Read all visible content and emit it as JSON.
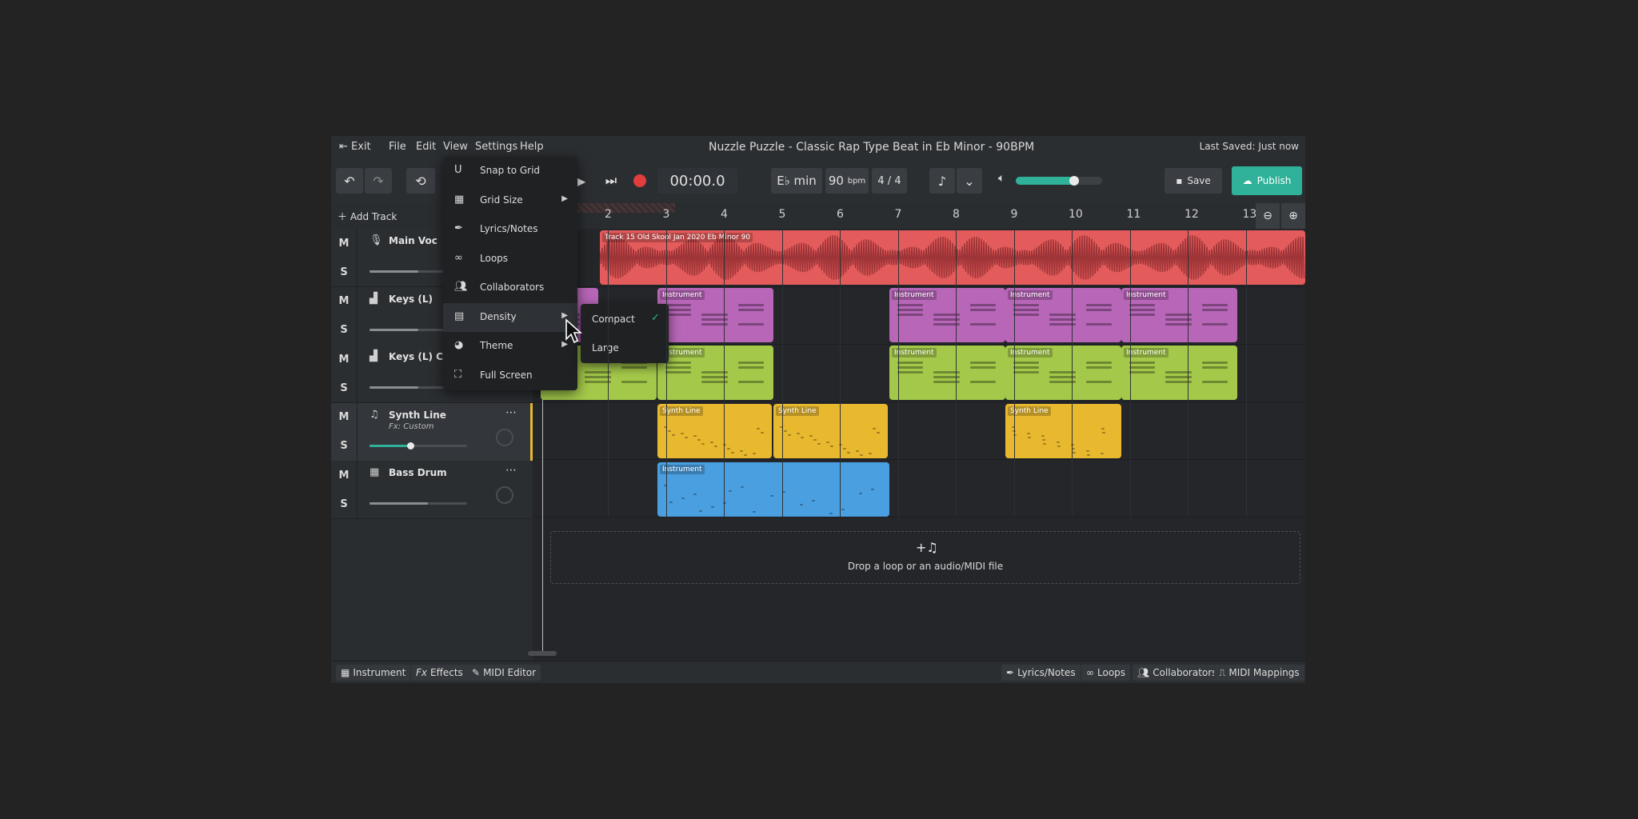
{
  "menubar": {
    "exit": "Exit",
    "file": "File",
    "edit": "Edit",
    "view": "View",
    "settings": "Settings",
    "help": "Help",
    "title": "Nuzzle Puzzle - Classic Rap Type Beat in Eb Minor - 90BPM",
    "last_saved": "Last Saved: Just now"
  },
  "toolbar": {
    "time": "00:00.0",
    "key": "E♭ min",
    "bpm_value": "90",
    "bpm_unit": "bpm",
    "time_signature": "4 / 4",
    "master_volume_level": 0.68,
    "save": "Save",
    "publish": "Publish",
    "accent": "#2fb19a"
  },
  "ruler": {
    "add_track": "Add Track",
    "ticks": [
      "2",
      "3",
      "4",
      "5",
      "6",
      "7",
      "8",
      "9",
      "10",
      "11",
      "12",
      "13"
    ]
  },
  "tracks": [
    {
      "name": "Main Voc",
      "icon": "microphone-icon",
      "mute": "M",
      "solo": "S",
      "volume_level": 0.5
    },
    {
      "name": "Keys (L)",
      "icon": "piano-icon",
      "mute": "M",
      "solo": "S",
      "volume_level": 0.5
    },
    {
      "name": "Keys (L) Copy",
      "icon": "piano-icon",
      "mute": "M",
      "solo": "S",
      "volume_level": 0.5
    },
    {
      "name": "Synth Line",
      "fx": "Fx: Custom",
      "icon": "synth-icon",
      "mute": "M",
      "solo": "S",
      "volume_level": 0.42
    },
    {
      "name": "Bass Drum",
      "icon": "drum-machine-icon",
      "mute": "M",
      "solo": "S",
      "volume_level": 0.6
    }
  ],
  "clips": {
    "audio_label": "Track 15 Old Skool Jan 2020 Eb Minor 90",
    "instrument": "Instrument",
    "synth": "Synth Line",
    "colors": {
      "audio": "#e35b5b",
      "keys": "#b866b8",
      "keys_copy": "#a4c94a",
      "synth": "#e8b92f",
      "drum": "#4a9fe0"
    }
  },
  "dropzone": {
    "icon": "add-music-icon",
    "text": "Drop a loop or an audio/MIDI file"
  },
  "view_menu": {
    "items": [
      {
        "label": "Snap to Grid",
        "icon": "magnet-icon"
      },
      {
        "label": "Grid Size",
        "icon": "grid-icon",
        "submenu": true
      },
      {
        "label": "Lyrics/Notes",
        "icon": "feather-icon"
      },
      {
        "label": "Loops",
        "icon": "infinity-icon"
      },
      {
        "label": "Collaborators",
        "icon": "users-icon"
      },
      {
        "label": "Density",
        "icon": "density-icon",
        "submenu": true
      },
      {
        "label": "Theme",
        "icon": "palette-icon",
        "submenu": true
      },
      {
        "label": "Full Screen",
        "icon": "fullscreen-icon"
      }
    ]
  },
  "density_menu": {
    "compact": "Compact",
    "large": "Large",
    "selected": "Compact"
  },
  "bottombar": {
    "instrument": "Instrument",
    "effects": "Effects",
    "midi_editor": "MIDI Editor",
    "lyrics": "Lyrics/Notes",
    "loops": "Loops",
    "collaborators": "Collaborators",
    "midi_mappings": "MIDI Mappings"
  }
}
